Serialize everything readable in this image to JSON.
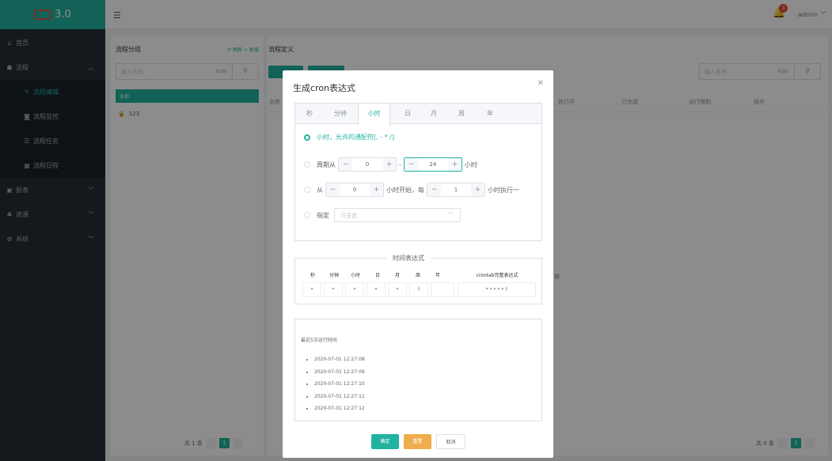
{
  "app": {
    "logo_text": "3.0",
    "user": "admin",
    "notifications": "3"
  },
  "sidebar": {
    "items": [
      {
        "label": "首页",
        "icon": "home-icon"
      },
      {
        "label": "流程",
        "icon": "sitemap-icon"
      },
      {
        "label": "流程编辑",
        "icon": "edit-icon"
      },
      {
        "label": "流程监控",
        "icon": "camera-icon"
      },
      {
        "label": "流程任务",
        "icon": "tasks-icon"
      },
      {
        "label": "流程日程",
        "icon": "calendar-icon"
      },
      {
        "label": "报表",
        "icon": "report-icon"
      },
      {
        "label": "资源",
        "icon": "resource-icon"
      },
      {
        "label": "系统",
        "icon": "cogs-icon"
      }
    ]
  },
  "groups": {
    "title": "流程分组",
    "links": "⟳ 刷新 + 新增",
    "search_placeholder": "输入名称",
    "count": "0/20",
    "all_label": "全部",
    "items": [
      "123"
    ],
    "pager_total": "共 1 条",
    "pager_page": "1"
  },
  "defs": {
    "title": "流程定义",
    "search_placeholder": "输入名称",
    "count": "0/20",
    "columns": {
      "name": "名称",
      "running": "执行中",
      "done": "已完成",
      "limit": "运行限制",
      "op": "操作"
    },
    "empty_fragment": "据",
    "pager_total": "共 0 条",
    "pager_page": "1"
  },
  "modal": {
    "title": "生成cron表达式",
    "tabs": [
      "秒",
      "分钟",
      "小时",
      "日",
      "月",
      "周",
      "年"
    ],
    "active_tab": "小时",
    "opt1": "小时，允许的通配符[, - * /]",
    "opt2_prefix": "周期从",
    "opt2_from": "0",
    "opt2_dash": "-",
    "opt2_to": "24",
    "opt2_suffix": "小时",
    "opt3_prefix": "从",
    "opt3_start": "0",
    "opt3_mid": "小时开始，每",
    "opt3_step": "1",
    "opt3_suffix": "小时执行一",
    "opt4_prefix": "指定",
    "opt4_placeholder": "可多选",
    "expr_legend": "时间表达式",
    "expr_headers": [
      "秒",
      "分钟",
      "小时",
      "日",
      "月",
      "周",
      "年",
      "crontab完整表达式"
    ],
    "expr_values": [
      "*",
      "*",
      "*",
      "*",
      "*",
      "?",
      "",
      "* * * * * ?"
    ],
    "times_title": "最近5次运行时间",
    "times": [
      "2020-07-01 12:27:08",
      "2020-07-01 12:27:09",
      "2020-07-01 12:27:10",
      "2020-07-01 12:27:11",
      "2020-07-01 12:27:12"
    ],
    "btn_ok": "确定",
    "btn_reset": "重置",
    "btn_cancel": "取消"
  },
  "colors": {
    "accent": "#21b3a1",
    "sidebar": "#272c33",
    "reset": "#f0ad4e",
    "badge": "#e74c3c"
  }
}
